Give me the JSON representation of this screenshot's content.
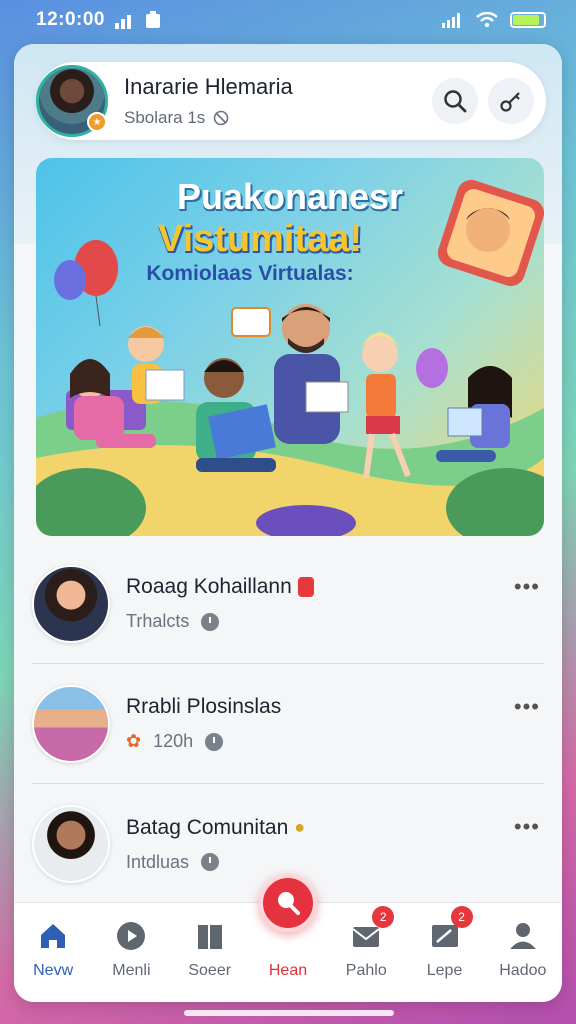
{
  "status_bar": {
    "time": "12:0:00",
    "battery_level": 0.85,
    "battery_color": "#b7f25a"
  },
  "profile": {
    "name": "Inararie Hlemaria",
    "subtitle": "Sbolara 1s",
    "accent_color": "#2fb3a0",
    "actions": [
      {
        "icon": "search-icon"
      },
      {
        "icon": "key-icon"
      }
    ]
  },
  "banner": {
    "title_line1": "Puakonanesr",
    "title_line2": "Vistumitaa!",
    "subtitle": "Komiolaas Virtualas:"
  },
  "feed": [
    {
      "title": "Roaag Kohaillann",
      "meta": "Trhalcts",
      "badge_color": "#e5373c"
    },
    {
      "title": "Rrabli Plosinslas",
      "meta": "120h"
    },
    {
      "title": "Batag Comunitan",
      "meta": "Intdluas"
    }
  ],
  "bottom_nav": [
    {
      "label": "Nevw",
      "icon": "home-icon",
      "state": "selected"
    },
    {
      "label": "Menli",
      "icon": "play-icon"
    },
    {
      "label": "Soeer",
      "icon": "book-icon"
    },
    {
      "label": "Hean",
      "icon": "search-icon",
      "state": "highlighted"
    },
    {
      "label": "Pahlo",
      "icon": "mail-icon",
      "badge": "2"
    },
    {
      "label": "Lepe",
      "icon": "edit-icon",
      "badge": "2"
    },
    {
      "label": "Hadoo",
      "icon": "user-icon"
    }
  ],
  "colors": {
    "active_nav": "#2f5fb5",
    "hear_accent": "#e4323f"
  }
}
